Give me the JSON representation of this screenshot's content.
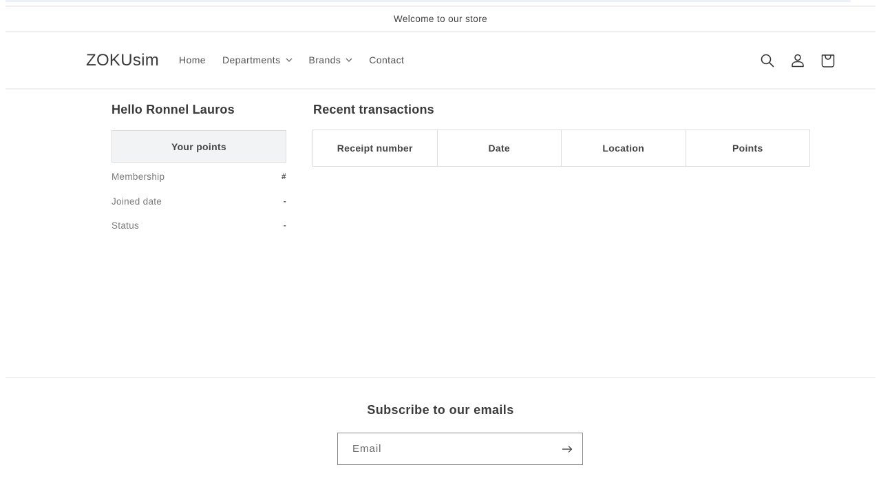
{
  "announcement": "Welcome to our store",
  "header": {
    "logo": "ZOKUsim",
    "nav": [
      {
        "label": "Home",
        "has_dropdown": false
      },
      {
        "label": "Departments",
        "has_dropdown": true
      },
      {
        "label": "Brands",
        "has_dropdown": true
      },
      {
        "label": "Contact",
        "has_dropdown": false
      }
    ],
    "icons": [
      "search-icon",
      "account-icon",
      "cart-icon"
    ]
  },
  "account": {
    "greeting": "Hello Ronnel Lauros",
    "points_label": "Your points",
    "info": [
      {
        "label": "Membership",
        "value": "#"
      },
      {
        "label": "Joined date",
        "value": "-"
      },
      {
        "label": "Status",
        "value": "-"
      }
    ]
  },
  "transactions": {
    "title": "Recent transactions",
    "columns": [
      "Receipt number",
      "Date",
      "Location",
      "Points"
    ],
    "rows": []
  },
  "footer": {
    "subscribe_title": "Subscribe to our emails",
    "email_placeholder": "Email",
    "email_value": ""
  }
}
